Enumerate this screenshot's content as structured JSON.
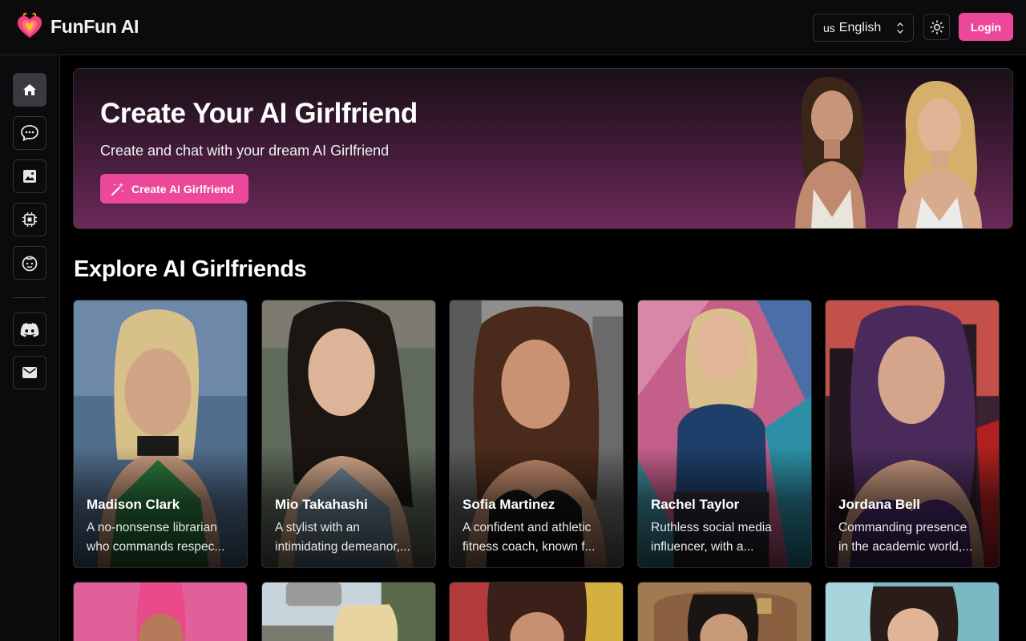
{
  "header": {
    "brand": "FunFun AI",
    "language": {
      "flag": "us",
      "label": "English"
    },
    "login_label": "Login"
  },
  "sidebar": {
    "items": [
      {
        "name": "home",
        "icon": "home-icon",
        "active": true
      },
      {
        "name": "chat",
        "icon": "chat-icon",
        "active": false
      },
      {
        "name": "gallery",
        "icon": "image-icon",
        "active": false
      },
      {
        "name": "generate",
        "icon": "chip-icon",
        "active": false
      },
      {
        "name": "create",
        "icon": "face-icon",
        "active": false
      }
    ],
    "footer_items": [
      {
        "name": "discord",
        "icon": "discord-icon"
      },
      {
        "name": "contact",
        "icon": "mail-icon"
      }
    ]
  },
  "hero": {
    "title": "Create Your AI Girlfriend",
    "subtitle": "Create and chat with your dream AI Girlfriend",
    "button_label": "Create AI Girlfriend"
  },
  "explore": {
    "title": "Explore AI Girlfriends",
    "cards": [
      {
        "name": "Madison Clark",
        "desc1": "A no-nonsense librarian",
        "desc2": "who commands respec..."
      },
      {
        "name": "Mio Takahashi",
        "desc1": "A stylist with an",
        "desc2": "intimidating demeanor,..."
      },
      {
        "name": "Sofia Martinez",
        "desc1": "A confident and athletic",
        "desc2": "fitness coach, known f..."
      },
      {
        "name": "Rachel Taylor",
        "desc1": "Ruthless social media",
        "desc2": "influencer, with a..."
      },
      {
        "name": "Jordana Bell",
        "desc1": "Commanding presence",
        "desc2": "in the academic world,..."
      }
    ]
  },
  "colors": {
    "accent": "#ec4899",
    "background": "#000000",
    "panel": "#0b0b0d",
    "border": "#333338"
  }
}
